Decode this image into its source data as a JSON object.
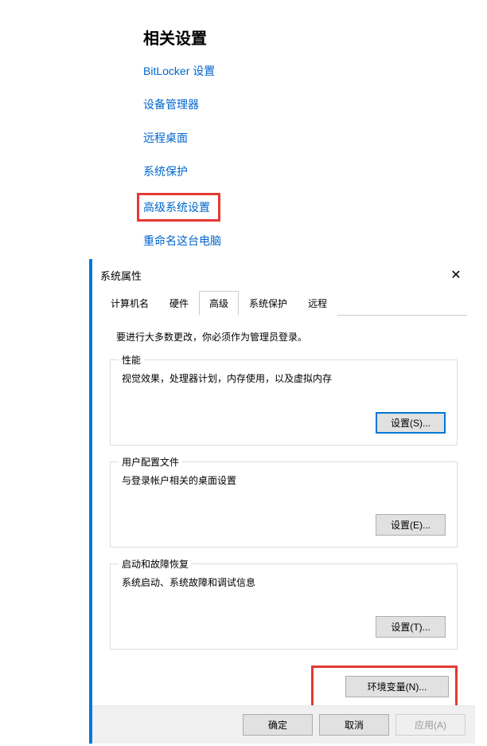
{
  "related": {
    "title": "相关设置",
    "links": {
      "bitlocker": "BitLocker 设置",
      "device_manager": "设备管理器",
      "remote_desktop": "远程桌面",
      "system_protection": "系统保护",
      "advanced_system": "高级系统设置",
      "rename_pc": "重命名这台电脑"
    }
  },
  "dialog": {
    "title": "系统属性",
    "tabs": {
      "computer_name": "计算机名",
      "hardware": "硬件",
      "advanced": "高级",
      "system_protection": "系统保护",
      "remote": "远程"
    },
    "admin_note": "要进行大多数更改，你必须作为管理员登录。",
    "performance": {
      "label": "性能",
      "desc": "视觉效果，处理器计划，内存使用，以及虚拟内存",
      "button": "设置(S)..."
    },
    "profiles": {
      "label": "用户配置文件",
      "desc": "与登录帐户相关的桌面设置",
      "button": "设置(E)..."
    },
    "startup": {
      "label": "启动和故障恢复",
      "desc": "系统启动、系统故障和调试信息",
      "button": "设置(T)..."
    },
    "env_button": "环境变量(N)...",
    "footer": {
      "ok": "确定",
      "cancel": "取消",
      "apply": "应用(A)"
    }
  }
}
